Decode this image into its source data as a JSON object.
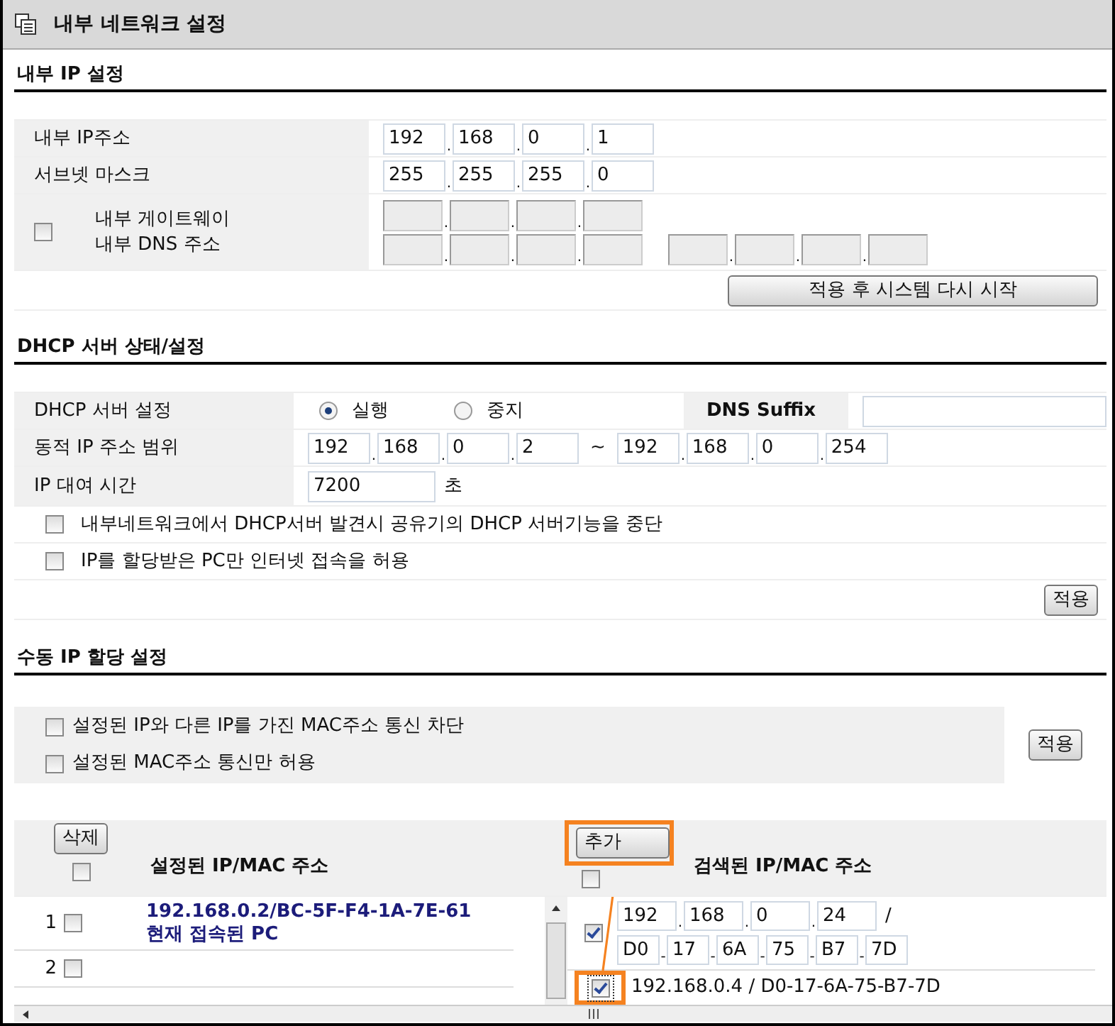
{
  "window": {
    "title": "내부 네트워크 설정"
  },
  "separators": {
    "ip": ".",
    "mac": "-"
  },
  "internal_ip": {
    "heading": "내부 IP 설정",
    "ip_label": "내부 IP주소",
    "ip": [
      "192",
      "168",
      "0",
      "1"
    ],
    "mask_label": "서브넷 마스크",
    "mask": [
      "255",
      "255",
      "255",
      "0"
    ],
    "custom": {
      "checked": false,
      "gateway_label": "내부 게이트웨이",
      "dns_label": "내부 DNS 주소"
    },
    "apply_button": "적용 후 시스템 다시 시작"
  },
  "dhcp": {
    "heading": "DHCP 서버 상태/설정",
    "server_label": "DHCP 서버 설정",
    "modes": [
      {
        "label": "실행",
        "selected": true
      },
      {
        "label": "중지",
        "selected": false
      }
    ],
    "dns_suffix_label": "DNS Suffix",
    "range_label": "동적 IP 주소 범위",
    "range_start": [
      "192",
      "168",
      "0",
      "2"
    ],
    "range_separator": "~",
    "range_end": [
      "192",
      "168",
      "0",
      "254"
    ],
    "lease_label": "IP 대여 시간",
    "lease": "7200",
    "lease_unit": "초",
    "options": [
      {
        "label": "내부네트워크에서 DHCP서버 발견시 공유기의 DHCP 서버기능을 중단",
        "checked": false
      },
      {
        "label": "IP를 할당받은 PC만 인터넷 접속을 허용",
        "checked": false
      }
    ],
    "apply_button": "적용"
  },
  "manual": {
    "heading": "수동 IP 할당 설정",
    "options": [
      {
        "label": "설정된 IP와 다른 IP를 가진 MAC주소 통신 차단",
        "checked": false
      },
      {
        "label": "설정된 MAC주소 통신만 허용",
        "checked": false
      }
    ],
    "apply_button": "적용",
    "delete_button": "삭제",
    "select_all_configured": false,
    "configured_heading": "설정된 IP/MAC 주소",
    "add_button": "추가",
    "select_all_found": false,
    "found_heading": "검색된 IP/MAC 주소",
    "configured": [
      {
        "index": "1",
        "checked": false,
        "address": "192.168.0.2/BC-5F-F4-1A-7E-61",
        "note": "현재 접속된 PC"
      },
      {
        "index": "2",
        "checked": false
      }
    ],
    "found": [
      {
        "kind": "editable",
        "checked": true,
        "ip": [
          "192",
          "168",
          "0",
          "24"
        ],
        "ip_mac_separator": "/",
        "mac": [
          "D0",
          "17",
          "6A",
          "75",
          "B7",
          "7D"
        ]
      },
      {
        "kind": "text",
        "checked": true,
        "text": "192.168.0.4 / D0-17-6A-75-B7-7D"
      }
    ]
  }
}
